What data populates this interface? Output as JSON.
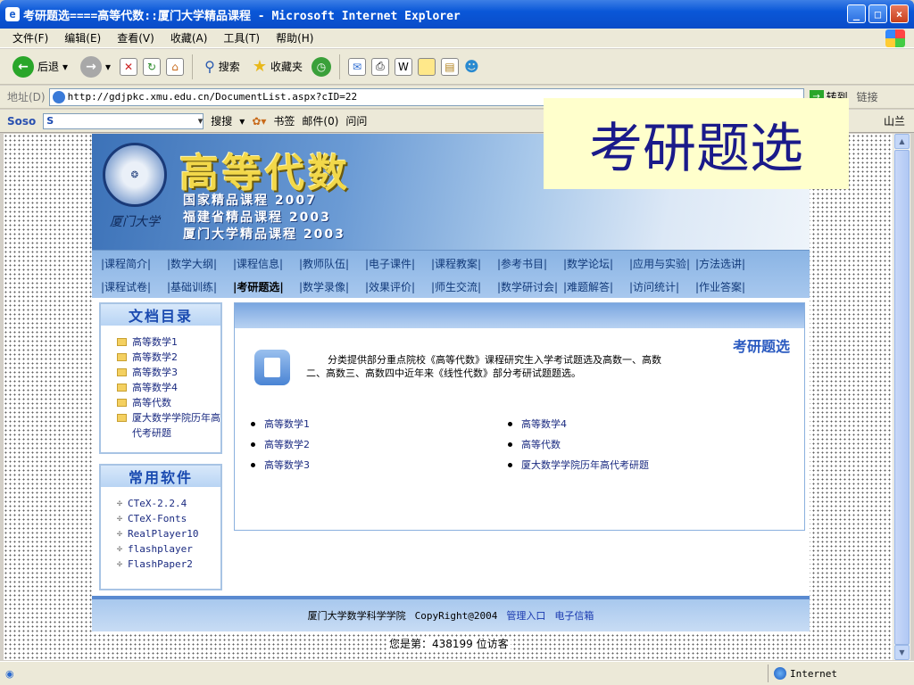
{
  "window": {
    "title": "考研题选====高等代数::厦门大学精品课程 - Microsoft Internet Explorer"
  },
  "menu": [
    "文件(F)",
    "编辑(E)",
    "查看(V)",
    "收藏(A)",
    "工具(T)",
    "帮助(H)"
  ],
  "toolbar": {
    "back": "后退",
    "search": "搜索",
    "favorites": "收藏夹"
  },
  "address": {
    "label": "地址(D)",
    "url": "http://gdjpkc.xmu.edu.cn/DocumentList.aspx?cID=22",
    "go": "转到",
    "links": "链接"
  },
  "soso": {
    "logo": "Soso",
    "input": "S",
    "search": "搜搜",
    "bookmark": "书签",
    "mail": "邮件(0)",
    "ask": "问问",
    "shanlan": "山兰"
  },
  "overlay": {
    "text": "考研题选"
  },
  "banner": {
    "title": "高等代数",
    "lines": [
      "国家精品课程 2007",
      "福建省精品课程 2003",
      "厦门大学精品课程 2003"
    ]
  },
  "nav": {
    "row1": [
      "|课程简介|",
      "|数学大纲|",
      "|课程信息|",
      "|教师队伍|",
      "|电子课件|",
      "|课程教案|",
      "|参考书目|",
      "|数学论坛|",
      "|应用与实验|",
      "|方法选讲|"
    ],
    "row2": [
      "|课程试卷|",
      "|基础训练|",
      "|考研题选|",
      "|数学录像|",
      "|效果评价|",
      "|师生交流|",
      "|数学研讨会|",
      "|难题解答|",
      "|访问统计|",
      "|作业答案|"
    ],
    "active": "|考研题选|"
  },
  "sidebar": {
    "docs_title": "文档目录",
    "docs": [
      "高等数学1",
      "高等数学2",
      "高等数学3",
      "高等数学4",
      "高等代数",
      "厦大数学学院历年高代考研题"
    ],
    "soft_title": "常用软件",
    "software": [
      "CTeX-2.2.4",
      "CTeX-Fonts",
      "RealPlayer10",
      "flashplayer",
      "FlashPaper2"
    ]
  },
  "main": {
    "section_title": "考研题选",
    "description": "分类提供部分重点院校《高等代数》课程研究生入学考试题选及高数一、高数二、高数三、高数四中近年来《线性代数》部分考研试题题选。",
    "left_links": [
      "高等数学1",
      "高等数学2",
      "高等数学3"
    ],
    "right_links": [
      "高等数学4",
      "高等代数",
      "厦大数学学院历年高代考研题"
    ]
  },
  "footer": {
    "org": "厦门大学数学科学学院",
    "copyright": "CopyRight@2004",
    "admin": "管理入口",
    "mail": "电子信箱"
  },
  "visits": {
    "text": "您是第：438199 位访客"
  },
  "status": {
    "zone": "Internet"
  }
}
